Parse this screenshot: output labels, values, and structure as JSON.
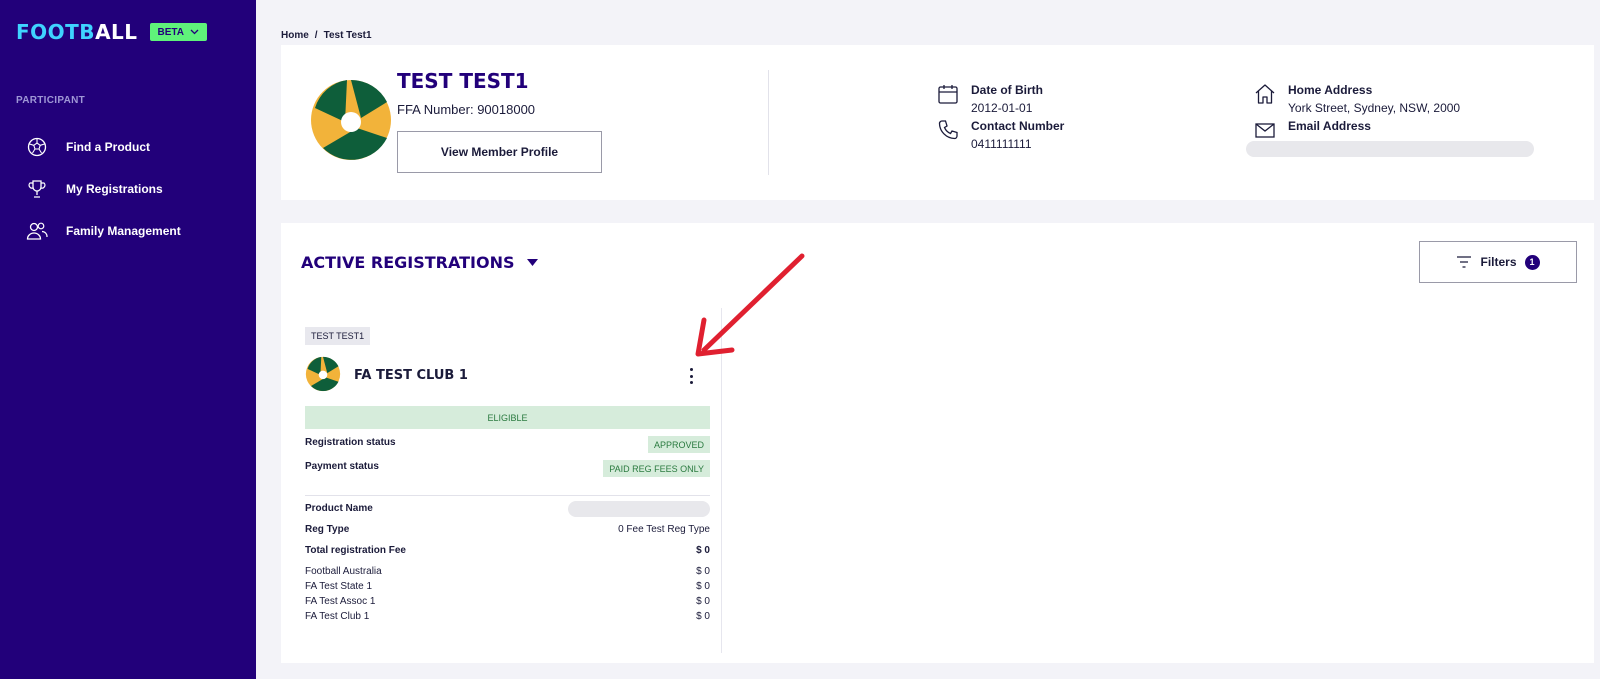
{
  "sidebar": {
    "brand_part1": "FOOTB",
    "brand_part2": "ALL",
    "beta_label": "BETA",
    "section_label": "PARTICIPANT",
    "items": [
      {
        "label": "Find a Product",
        "icon": "soccer-ball-icon"
      },
      {
        "label": "My Registrations",
        "icon": "trophy-icon"
      },
      {
        "label": "Family Management",
        "icon": "users-icon"
      }
    ]
  },
  "breadcrumb": {
    "home": "Home",
    "separator": "/",
    "current": "Test Test1"
  },
  "profile": {
    "name": "TEST TEST1",
    "ffa_number": "FFA Number: 90018000",
    "view_button": "View Member Profile",
    "dob_label": "Date of Birth",
    "dob_value": "2012-01-01",
    "contact_label": "Contact Number",
    "contact_value": "0411111111",
    "address_label": "Home Address",
    "address_value": "York Street, Sydney, NSW, 2000",
    "email_label": "Email Address"
  },
  "registrations": {
    "title": "ACTIVE REGISTRATIONS",
    "filters_label": "Filters",
    "filters_count": "1",
    "card": {
      "participant_tag": "TEST TEST1",
      "club_name": "FA TEST CLUB 1",
      "eligibility": "ELIGIBLE",
      "registration_status_label": "Registration status",
      "registration_status": "APPROVED",
      "payment_status_label": "Payment status",
      "payment_status": "PAID REG FEES ONLY",
      "product_name_label": "Product Name",
      "reg_type_label": "Reg Type",
      "reg_type": "0 Fee Test Reg Type",
      "total_fee_label": "Total registration Fee",
      "total_fee": "$ 0",
      "fees": [
        {
          "label": "Football Australia",
          "value": "$ 0"
        },
        {
          "label": "FA Test State 1",
          "value": "$ 0"
        },
        {
          "label": "FA Test Assoc 1",
          "value": "$ 0"
        },
        {
          "label": "FA Test Club 1",
          "value": "$ 0"
        }
      ]
    }
  },
  "colors": {
    "sidebar_bg": "#22007a",
    "accent_cyan": "#3fd3ff",
    "beta_green": "#5ff27a",
    "status_green_bg": "#d6ecdb",
    "status_green_text": "#2a7a3f",
    "annotation_red": "#e02030"
  }
}
